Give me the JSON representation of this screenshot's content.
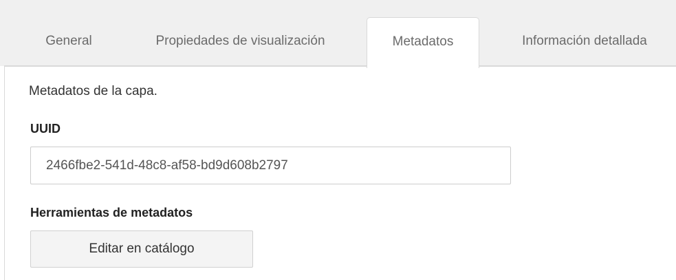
{
  "tabs": [
    {
      "label": "General",
      "active": false
    },
    {
      "label": "Propiedades de visualización",
      "active": false
    },
    {
      "label": "Metadatos",
      "active": true
    },
    {
      "label": "Información detallada",
      "active": false
    }
  ],
  "panel": {
    "intro": "Metadatos de la capa.",
    "uuid_label": "UUID",
    "uuid_value": "2466fbe2-541d-48c8-af58-bd9d608b2797",
    "tools_label": "Herramientas de metadatos",
    "edit_button_label": "Editar en catálogo"
  },
  "colors": {
    "tabbar_background": "#f0f0f0",
    "border": "#d9d9d9",
    "button_background": "#f4f4f4"
  }
}
